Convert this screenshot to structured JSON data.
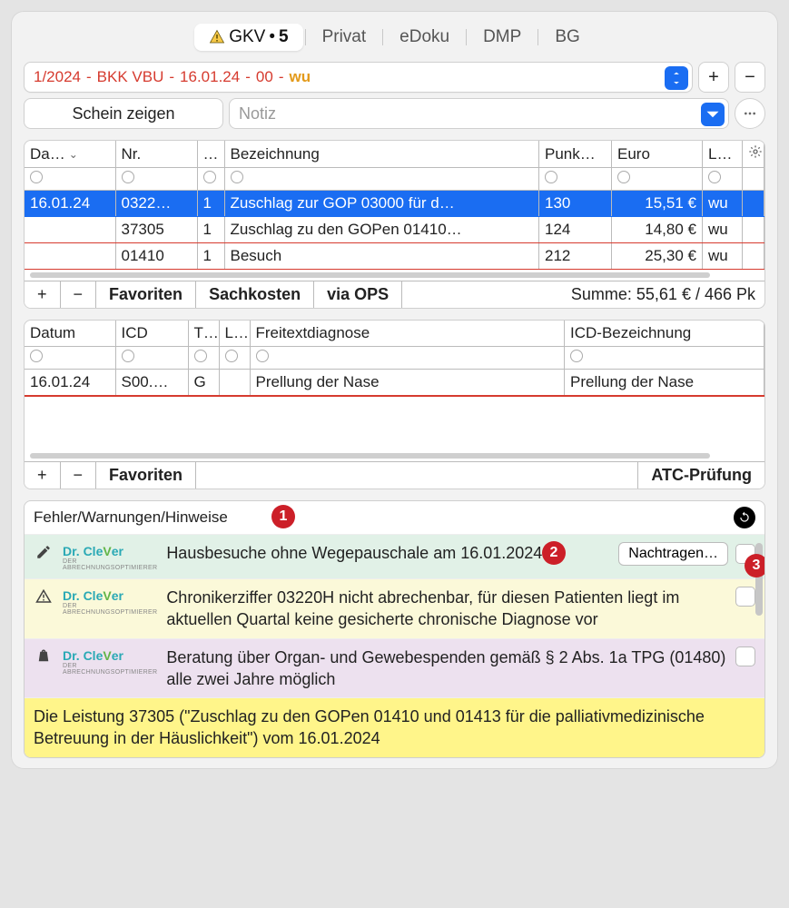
{
  "tabs": {
    "gkv": "GKV",
    "gkv_count": "5",
    "privat": "Privat",
    "edoku": "eDoku",
    "dmp": "DMP",
    "bg": "BG"
  },
  "case": {
    "quarter": "1/2024",
    "sep1": " - ",
    "insurer": "BKK VBU",
    "sep2": " - ",
    "date": "16.01.24",
    "sep3": " - ",
    "code": "00",
    "sep4": " - ",
    "user": "wu"
  },
  "buttons": {
    "plus": "+",
    "minus": "−",
    "show_schein": "Schein zeigen",
    "note_placeholder": "Notiz"
  },
  "services": {
    "headers": {
      "date": "Da…",
      "nr": "Nr.",
      "cnt": "…",
      "desc": "Bezeichnung",
      "pts": "Punk…",
      "euro": "Euro",
      "le": "Le…"
    },
    "rows": [
      {
        "date": "16.01.24",
        "nr": "0322…",
        "cnt": "1",
        "desc": "Zuschlag zur GOP 03000 für d…",
        "pts": "130",
        "euro": "15,51 €",
        "le": "wu",
        "selected": true
      },
      {
        "date": "",
        "nr": "37305",
        "cnt": "1",
        "desc": "Zuschlag zu den GOPen 01410…",
        "pts": "124",
        "euro": "14,80 €",
        "le": "wu",
        "selected": false
      },
      {
        "date": "",
        "nr": "01410",
        "cnt": "1",
        "desc": "Besuch",
        "pts": "212",
        "euro": "25,30 €",
        "le": "wu",
        "selected": false
      }
    ],
    "footer": {
      "fav": "Favoriten",
      "sach": "Sachkosten",
      "ops": "via OPS",
      "sum": "Summe: 55,61 € / 466 Pk"
    }
  },
  "diag": {
    "headers": {
      "date": "Datum",
      "icd": "ICD",
      "t": "T…",
      "l": "L…",
      "free": "Freitextdiagnose",
      "icddesc": "ICD-Bezeichnung"
    },
    "rows": [
      {
        "date": "16.01.24",
        "icd": "S00.…",
        "t": "G",
        "l": "",
        "free": "Prellung der Nase",
        "icddesc": "Prellung der Nase"
      }
    ],
    "footer": {
      "fav": "Favoriten",
      "atc": "ATC-Prüfung"
    }
  },
  "hints": {
    "title": "Fehler/Warnungen/Hinweise",
    "clever_brand": "Dr. CleVer",
    "clever_sub": "DER ABRECHNUNGSOPTIMIERER",
    "items": [
      {
        "bg": "green",
        "icon": "pencil",
        "text": "Hausbesuche ohne Wegepauschale am 16.01.2024",
        "action": "Nachtragen…",
        "chk": true
      },
      {
        "bg": "yellow",
        "icon": "warn",
        "text": "Chronikerziffer 03220H nicht abrechenbar, für diesen Patienten liegt im aktuellen Quartal keine gesicherte chronische Diagnose vor",
        "chk": true
      },
      {
        "bg": "purple",
        "icon": "bag",
        "text": "Beratung über Organ- und Gewebespenden gemäß § 2 Abs. 1a TPG (01480) alle zwei Jahre möglich",
        "chk": true
      }
    ],
    "bottom": "Die Leistung 37305 (\"Zuschlag zu den GOPen 01410 und 01413 für die palliativmedizinische Betreuung in der Häuslichkeit\") vom 16.01.2024"
  },
  "annotations": {
    "a1": "1",
    "a2": "2",
    "a3": "3"
  }
}
